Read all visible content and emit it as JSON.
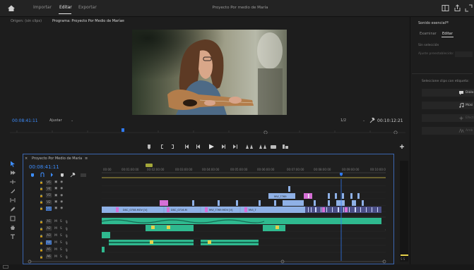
{
  "topbar": {
    "tabs": [
      "Importar",
      "Editar",
      "Exportar"
    ],
    "title": "Proyecto Por medio de María"
  },
  "monitor": {
    "source_tab": "Origen: (sin clips)",
    "program_tab": "Programa: Proyecto Por Medio de María",
    "program_menu": "≡",
    "timecode_left": "00:08:41:11",
    "fit_label": "Ajustar",
    "resolution_label": "1/2",
    "timecode_right": "00:10:12:21"
  },
  "timeline": {
    "close": "×",
    "title": "Proyecto Por Medio de María",
    "menu": "≡",
    "timecode": "00:08:41:11",
    "ruler_labels": [
      "00:00",
      "00:01:00:00",
      "00:02:00:00",
      "00:03:00:00",
      "00:04:00:00",
      "00:05:00:00",
      "00:06:00:00",
      "00:07:00:00",
      "00:08:00:00",
      "00:09:00:00",
      "00:10:00:00"
    ],
    "video_tracks": [
      {
        "name": "V5"
      },
      {
        "name": "V4"
      },
      {
        "name": "V3"
      },
      {
        "name": "V2"
      },
      {
        "name": "V1",
        "selected": true
      }
    ],
    "audio_tracks": [
      {
        "name": "A1"
      },
      {
        "name": "A2"
      },
      {
        "name": "A3"
      },
      {
        "name": "A4",
        "selected": true
      },
      {
        "name": "A5"
      },
      {
        "name": "A6"
      }
    ],
    "clips": [
      {
        "label": "DSC_0708.MOV [V]"
      },
      {
        "label": "DSC_0716.M"
      },
      {
        "label": "MVI_7769.MOV [V]"
      },
      {
        "label": "MVI_7"
      },
      {
        "label": "MVI_7769"
      }
    ],
    "meter_label": "S S"
  },
  "essential_sound": {
    "title": "Sonido esencial",
    "menu": "≡",
    "tabs": [
      "Examinar",
      "Editar"
    ],
    "no_selection": "Sin selección",
    "preset_label": "Ajuste preestablecido:",
    "prompt": "Seleccione clips con etiqueta:",
    "buttons": [
      {
        "label": "Diálo",
        "disabled": false
      },
      {
        "label": "Músi",
        "disabled": false
      },
      {
        "label": "Efect",
        "disabled": true
      },
      {
        "label": "Amb",
        "disabled": true
      }
    ]
  },
  "colors": {
    "accent": "#3d8eff",
    "video_clip": "#8fb1e6",
    "audio_clip": "#2fb98f",
    "marker_yellow": "#e6d14a",
    "pink": "#d66fd6",
    "panel_border": "#3b66b0"
  }
}
